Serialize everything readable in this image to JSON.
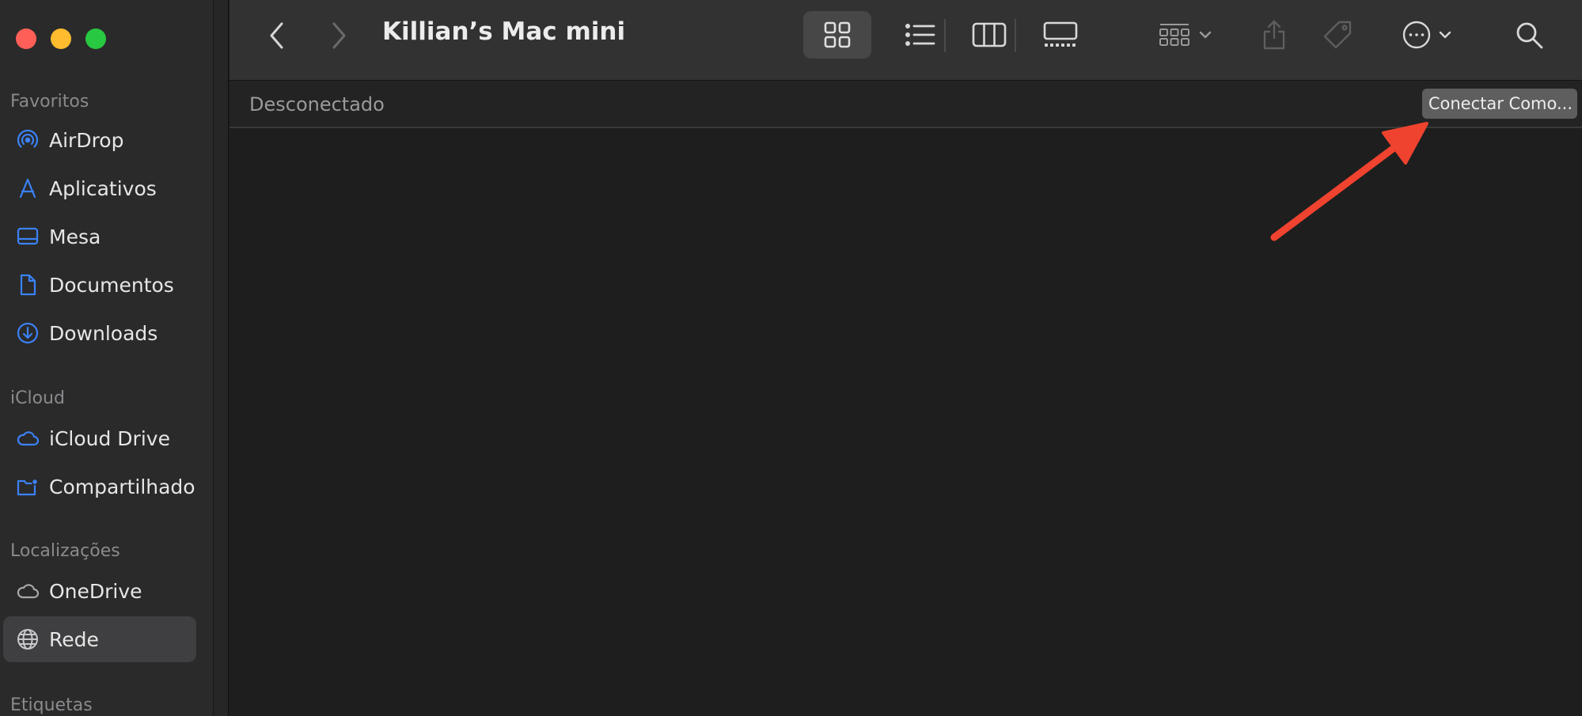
{
  "window": {
    "title": "Killian’s Mac mini"
  },
  "sidebar": {
    "sections": [
      {
        "title": "Favoritos"
      },
      {
        "title": "iCloud"
      },
      {
        "title": "Localizações"
      },
      {
        "title": "Etiquetas"
      }
    ],
    "favorites": [
      {
        "label": "AirDrop",
        "icon": "airdrop-icon"
      },
      {
        "label": "Aplicativos",
        "icon": "applications-icon"
      },
      {
        "label": "Mesa",
        "icon": "desktop-icon"
      },
      {
        "label": "Documentos",
        "icon": "document-icon"
      },
      {
        "label": "Downloads",
        "icon": "download-icon"
      }
    ],
    "icloud": [
      {
        "label": "iCloud Drive",
        "icon": "cloud-icon"
      },
      {
        "label": "Compartilhado",
        "icon": "shared-folder-icon"
      }
    ],
    "locations": [
      {
        "label": "OneDrive",
        "icon": "cloud-icon"
      },
      {
        "label": "Rede",
        "icon": "globe-icon",
        "selected": true
      }
    ]
  },
  "status": {
    "text": "Desconectado",
    "connect_label": "Conectar Como..."
  },
  "colors": {
    "accent": "#3b82f6",
    "annotation_arrow": "#f0432f",
    "close": "#ff5f57",
    "minimize": "#febc2e",
    "zoom": "#28c840"
  }
}
